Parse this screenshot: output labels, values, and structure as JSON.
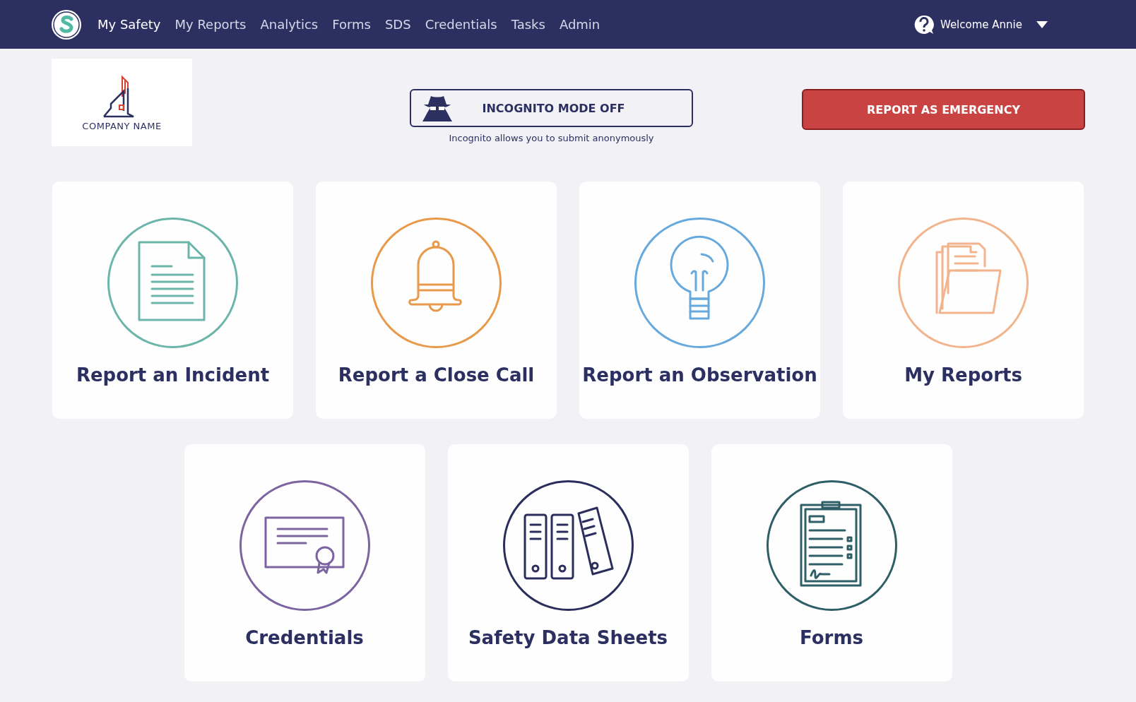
{
  "nav": {
    "items": [
      {
        "label": "My Safety",
        "selected": true
      },
      {
        "label": "My Reports",
        "selected": false
      },
      {
        "label": "Analytics",
        "selected": false
      },
      {
        "label": "Forms",
        "selected": false
      },
      {
        "label": "SDS",
        "selected": false
      },
      {
        "label": "Credentials",
        "selected": false
      },
      {
        "label": "Tasks",
        "selected": false
      },
      {
        "label": "Admin",
        "selected": false
      }
    ],
    "user": {
      "label": "Welcome Annie"
    }
  },
  "company_logo": {
    "label": "COMPANY NAME"
  },
  "incognito": {
    "label": "INCOGNITO MODE OFF",
    "on": false,
    "caption": "Incognito allows you to submit anonymously"
  },
  "emergency_button": {
    "label": "REPORT AS EMERGENCY"
  },
  "tiles": [
    {
      "label": "Report an Incident",
      "kind": "document",
      "color": "#6bb5aa"
    },
    {
      "label": "Report a Close Call",
      "kind": "bell",
      "color": "#e8994a"
    },
    {
      "label": "Report an Observation",
      "kind": "bulb",
      "color": "#67a9dc"
    },
    {
      "label": "My Reports",
      "kind": "folder",
      "color": "#f2b48c"
    },
    {
      "label": "Credentials",
      "kind": "certificate",
      "color": "#7b64a0"
    },
    {
      "label": "Safety Data Sheets",
      "kind": "binders",
      "color": "#2b2e5c"
    },
    {
      "label": "Forms",
      "kind": "clipboard",
      "color": "#2e5e66"
    }
  ]
}
